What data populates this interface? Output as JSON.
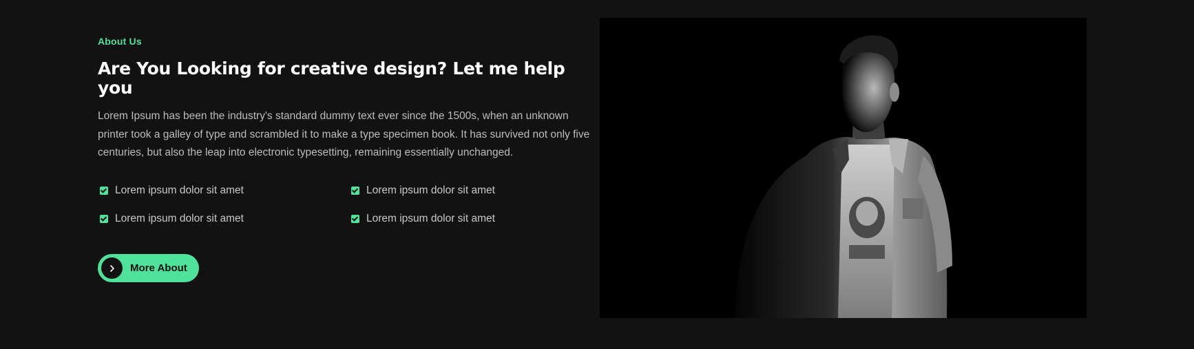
{
  "about": {
    "eyebrow": "About Us",
    "title": "Are You Looking for creative design? Let me help you",
    "description": "Lorem Ipsum has been the industry's standard dummy text ever since the 1500s, when an unknown printer took a galley of type and scrambled it to make a type specimen book. It has survived not only five centuries, but also the leap into electronic typesetting, remaining essentially unchanged.",
    "features": [
      {
        "label": "Lorem ipsum dolor sit amet",
        "icon": "checkbox-icon"
      },
      {
        "label": "Lorem ipsum dolor sit amet",
        "icon": "checkbox-icon"
      },
      {
        "label": "Lorem ipsum dolor sit amet",
        "icon": "checkbox-icon"
      },
      {
        "label": "Lorem ipsum dolor sit amet",
        "icon": "checkbox-icon"
      }
    ],
    "button": {
      "label": "More About",
      "icon": "chevron-right-icon"
    }
  },
  "photo": {
    "subject": "portrait-photo"
  },
  "colors": {
    "background": "#121212",
    "accent": "#4ee29a",
    "title": "#ffffff",
    "body_text": "#bdbdbd",
    "photo_background": "#000000"
  }
}
